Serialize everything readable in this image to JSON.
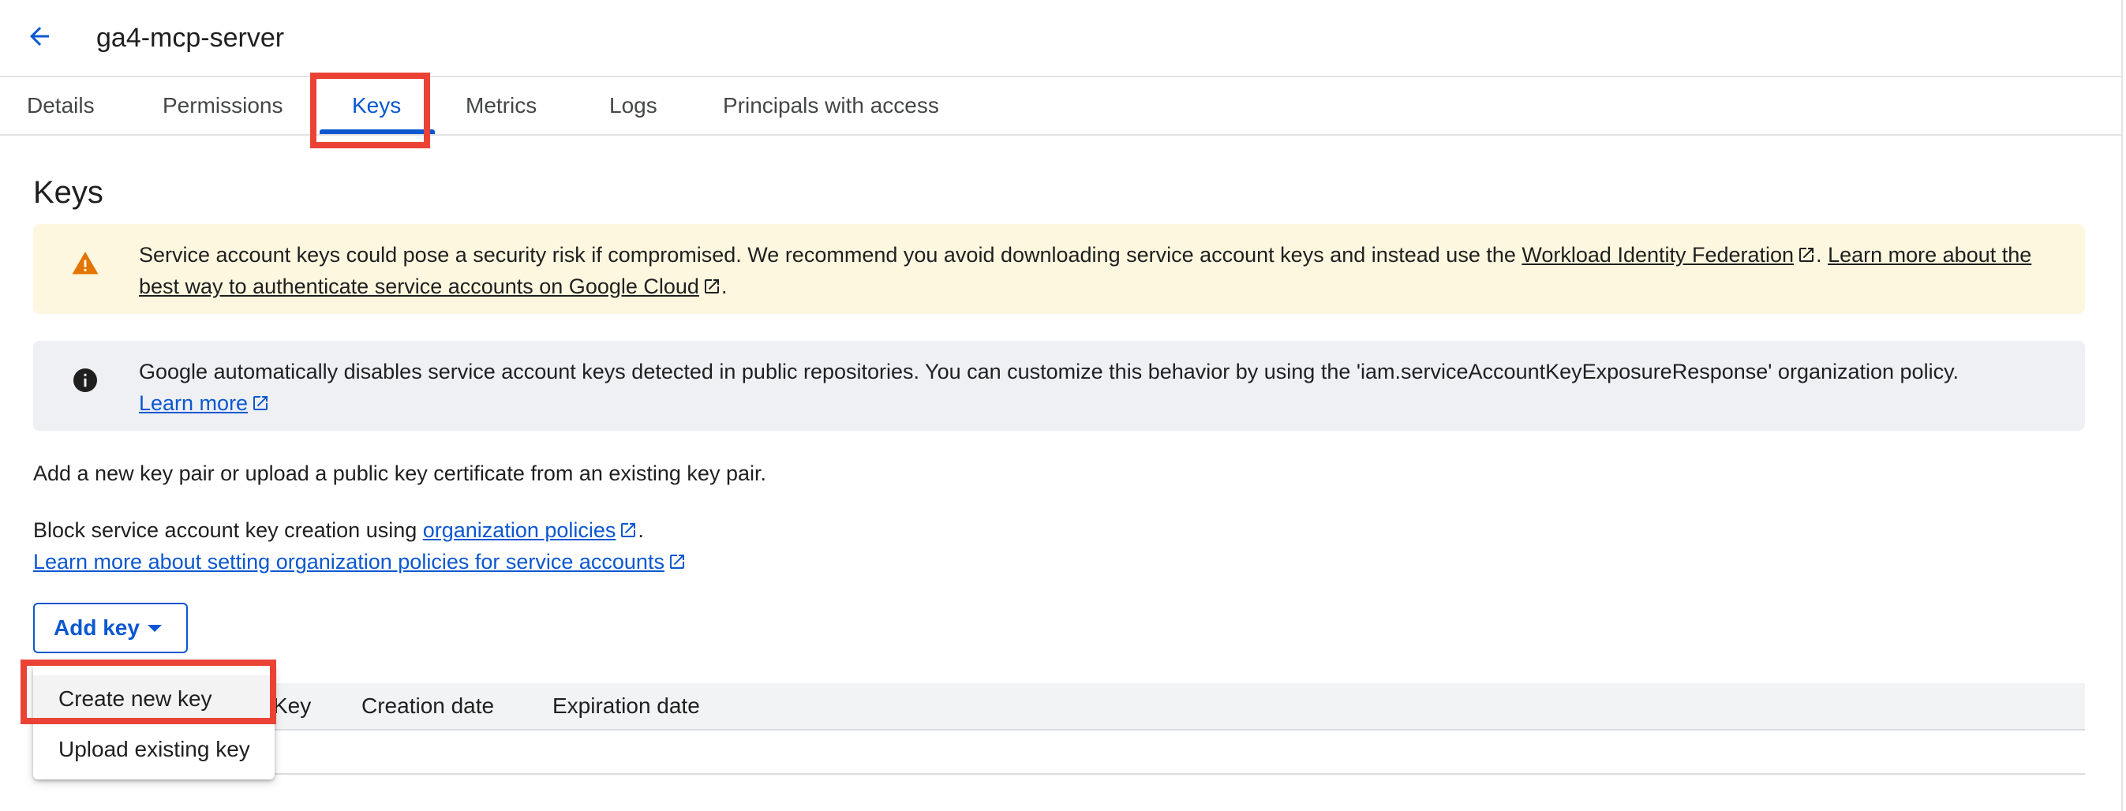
{
  "header": {
    "title": "ga4-mcp-server"
  },
  "tabs": [
    {
      "label": "Details"
    },
    {
      "label": "Permissions"
    },
    {
      "label": "Keys"
    },
    {
      "label": "Metrics"
    },
    {
      "label": "Logs"
    },
    {
      "label": "Principals with access"
    }
  ],
  "keys": {
    "title": "Keys",
    "warning_banner": {
      "text_before": "Service account keys could pose a security risk if compromised. We recommend you avoid downloading service account keys and instead use the ",
      "link1": "Workload Identity Federation",
      "middle": ". ",
      "link2": "Learn more about the best way to authenticate service accounts on Google Cloud",
      "end": "."
    },
    "info_banner": {
      "text": "Google automatically disables service account keys detected in public repositories. You can customize this behavior by using the 'iam.serviceAccountKeyExposureResponse' organization policy.",
      "link": "Learn more"
    },
    "description": "Add a new key pair or upload a public key certificate from an existing key pair.",
    "block_text": "Block service account key creation using ",
    "block_link": "organization policies",
    "block_end": ".",
    "learn_more_link": "Learn more about setting organization policies for service accounts",
    "add_key_label": "Add key",
    "table": {
      "columns": [
        "Key",
        "Creation date",
        "Expiration date"
      ]
    },
    "menu": {
      "items": [
        "Create new key",
        "Upload existing key"
      ]
    }
  },
  "colors": {
    "accent": "#0b57d0",
    "highlight": "#ea4335",
    "warning_bg": "#fef7e0",
    "warning_icon": "#e37400",
    "info_bg": "#eef0f4"
  }
}
